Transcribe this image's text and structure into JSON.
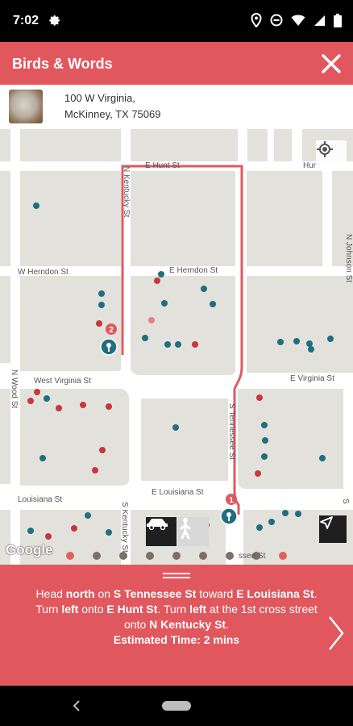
{
  "status": {
    "time": "7:02"
  },
  "app": {
    "title": "Birds & Words"
  },
  "address": {
    "line1": "100 W Virginia,",
    "line2": "McKinney, TX 75069"
  },
  "map": {
    "streets": {
      "e_hunt": "E Hunt St",
      "hunt_right": "Hunt",
      "w_herndon": "W Herndon St",
      "e_herndon": "E Herndon St",
      "west_virginia": "West Virginia St",
      "e_virginia": "E Virginia St",
      "e_louisiana": "E Louisiana St",
      "louisiana": "Louisiana St",
      "n_kentucky": "N Kentucky St",
      "n_johnson": "N Johnson St",
      "n_wood": "N Wood St",
      "s_kentucky": "S Kentucky St",
      "s_tennessee_upper": "S Tennessee St",
      "s_tennessee_lower": "ssee St",
      "s_right": "S"
    },
    "markers": {
      "marker_2": "2",
      "marker_1": "1"
    },
    "google": "Google",
    "colors": {
      "route": "#e0585e",
      "teal": "#1f6e82",
      "red": "#c6373c",
      "block": "#e3e1dc"
    }
  },
  "directions": {
    "parts": [
      [
        "Head ",
        false
      ],
      [
        "north",
        true
      ],
      [
        " on ",
        false
      ],
      [
        "S Tennessee St",
        true
      ],
      [
        " toward ",
        false
      ],
      [
        "E Louisiana St",
        true
      ],
      [
        ". Turn ",
        false
      ],
      [
        "left",
        true
      ],
      [
        " onto ",
        false
      ],
      [
        "E Hunt St",
        true
      ],
      [
        ". Turn ",
        false
      ],
      [
        "left",
        true
      ],
      [
        " at the 1st cross street onto ",
        false
      ],
      [
        "N Kentucky St",
        true
      ],
      [
        ".",
        false
      ]
    ],
    "estimated": "Estimated Time: 2 mins"
  }
}
